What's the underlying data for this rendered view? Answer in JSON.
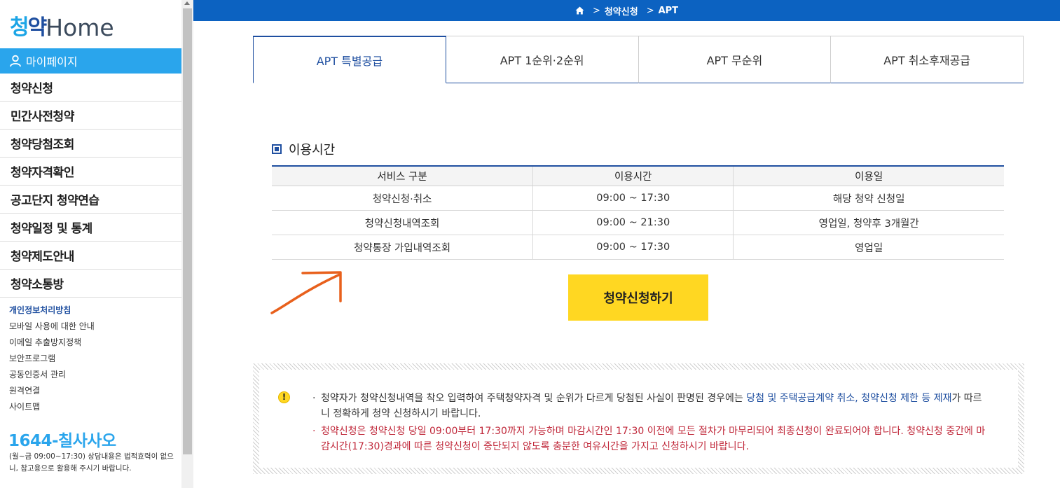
{
  "sidebar": {
    "logo_kr_part1": "청",
    "logo_kr_part2": "약",
    "logo_en": "Home",
    "mypage_label": "마이페이지",
    "menu": [
      {
        "label": "청약신청"
      },
      {
        "label": "민간사전청약"
      },
      {
        "label": "청약당첨조회"
      },
      {
        "label": "청약자격확인"
      },
      {
        "label": "공고단지 청약연습"
      },
      {
        "label": "청약일정 및 통계"
      },
      {
        "label": "청약제도안내"
      },
      {
        "label": "청약소통방"
      }
    ],
    "links": [
      {
        "label": "개인정보처리방침"
      },
      {
        "label": "모바일 사용에 대한 안내"
      },
      {
        "label": "이메일 추출방지정책"
      },
      {
        "label": "보안프로그램"
      },
      {
        "label": "공동인증서 관리"
      },
      {
        "label": "원격연결"
      },
      {
        "label": "사이트맵"
      }
    ],
    "phone": "1644-칠사사오",
    "phone_note": "(월~금 09:00~17:30) 상담내용은 법적효력이 없으니, 참고용으로 활용해 주시기 바랍니다."
  },
  "breadcrumb": {
    "items": [
      "청약신청",
      "APT"
    ]
  },
  "tabs": [
    {
      "label": "APT 특별공급",
      "active": true
    },
    {
      "label": "APT 1순위·2순위",
      "active": false
    },
    {
      "label": "APT 무순위",
      "active": false
    },
    {
      "label": "APT 취소후재공급",
      "active": false
    }
  ],
  "hours": {
    "title": "이용시간",
    "headers": [
      "서비스 구분",
      "이용시간",
      "이용일"
    ],
    "rows": [
      [
        "청약신청·취소",
        "09:00 ~ 17:30",
        "해당 청약 신청일"
      ],
      [
        "청약신청내역조회",
        "09:00 ~ 21:30",
        "영업일, 청약후 3개월간"
      ],
      [
        "청약통장 가입내역조회",
        "09:00 ~ 17:30",
        "영업일"
      ]
    ]
  },
  "apply_button": "청약신청하기",
  "notice": {
    "p1_a": "청약자가 청약신청내역을 착오 입력하여 주택청약자격 및 순위가 다르게 당첨된 사실이 판명된 경우에는 ",
    "p1_b": "당첨 및 주택공급계약 취소, 청약신청 제한 등 제재",
    "p1_c": "가 따르니 정확하게 청약 신청하시기 바랍니다.",
    "p2": "청약신청은 청약신청 당일 09:00부터 17:30까지 가능하며 마감시간인 17:30 이전에 모든 절차가 마무리되어 최종신청이 완료되어야 합니다. 청약신청 중간에 마감시간(17:30)경과에 따른 청약신청이 중단되지 않도록 충분한 여유시간을 가지고 신청하시기 바랍니다.",
    "bullet": "·",
    "warn_symbol": "!"
  },
  "colors": {
    "primary": "#1f4fa0",
    "topbar": "#0c62c1",
    "sky": "#2aa5ec",
    "button": "#ffd722",
    "alert": "#c0283a",
    "annotation": "#e8601c"
  }
}
